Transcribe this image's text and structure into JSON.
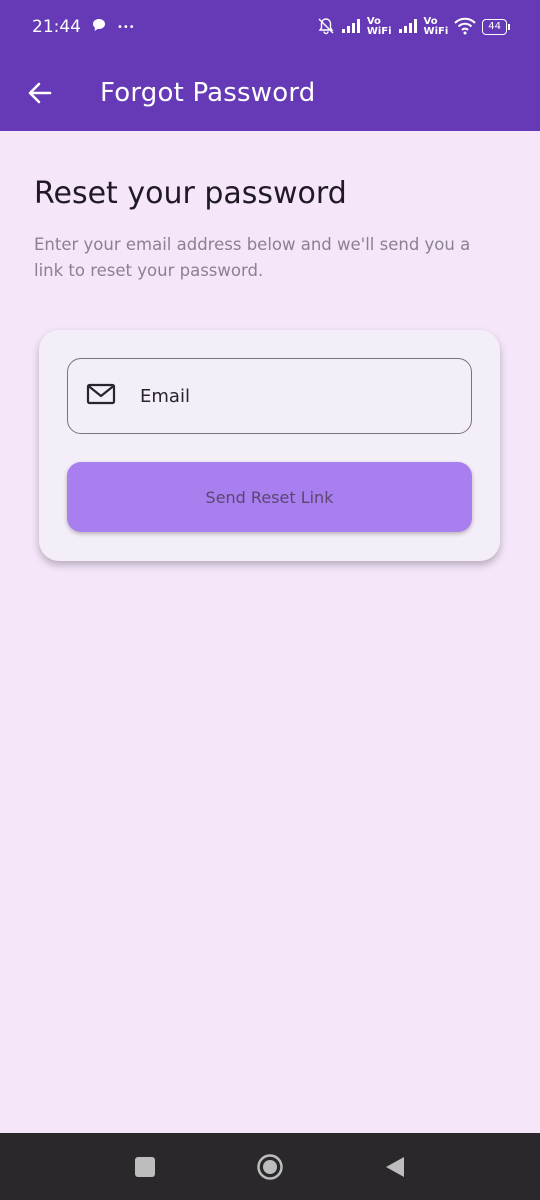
{
  "status_bar": {
    "time": "21:44",
    "more": "•••",
    "vo_label": "Vo",
    "wifi_label": "WiFi",
    "battery": "44"
  },
  "app_bar": {
    "title": "Forgot Password"
  },
  "content": {
    "heading": "Reset your password",
    "description": "Enter your email address below and we'll send you a link to reset your password."
  },
  "form": {
    "email_placeholder": "Email",
    "submit_label": "Send Reset Link"
  },
  "colors": {
    "primary": "#6639b6",
    "background": "#f5e6fa",
    "button": "#a97ff0",
    "nav_bar": "#2b282c"
  }
}
